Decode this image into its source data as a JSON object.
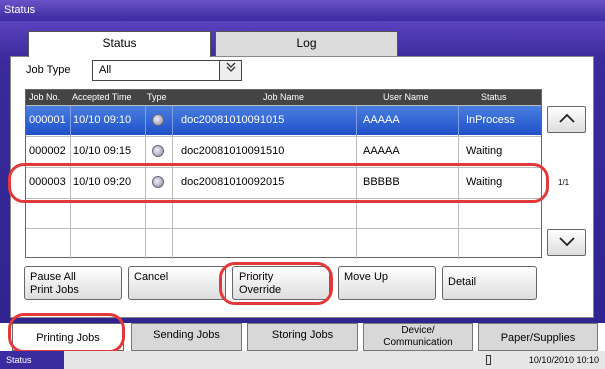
{
  "window_title": "Status",
  "tabs": [
    {
      "label": "Status",
      "active": true
    },
    {
      "label": "Log",
      "active": false
    }
  ],
  "job_type": {
    "label": "Job Type",
    "value": "All",
    "arrow_icon": "double-chevron-down-icon"
  },
  "table": {
    "headers": [
      "Job No.",
      "Accepted Time",
      "Type",
      "Job Name",
      "User Name",
      "Status"
    ],
    "rows": [
      {
        "job_no": "000001",
        "time": "10/10 09:10",
        "name": "doc20081010091015",
        "user": "AAAAA",
        "status": "InProcess",
        "selected": true
      },
      {
        "job_no": "000002",
        "time": "10/10 09:15",
        "name": "doc20081010091510",
        "user": "AAAAA",
        "status": "Waiting",
        "selected": false
      },
      {
        "job_no": "000003",
        "time": "10/10 09:20",
        "name": "doc20081010092015",
        "user": "BBBBB",
        "status": "Waiting",
        "selected": false
      }
    ]
  },
  "pager": {
    "indicator": "1/1",
    "up_icon": "chevron-up-icon",
    "down_icon": "chevron-down-icon"
  },
  "buttons": {
    "pause_all": "Pause All\nPrint Jobs",
    "cancel": "Cancel",
    "priority_override": "Priority\nOverride",
    "move_up": "Move Up",
    "detail": "Detail"
  },
  "bottom_tabs": [
    "Printing Jobs",
    "Sending Jobs",
    "Storing Jobs",
    "Device/\nCommunication",
    "Paper/Supplies"
  ],
  "statusbar": {
    "label": "Status",
    "datetime": "10/10/2010  10:10"
  },
  "colors": {
    "frame": "#3c2aa0",
    "selected_row": "#1e50c8",
    "highlight": "#e23a3a"
  }
}
